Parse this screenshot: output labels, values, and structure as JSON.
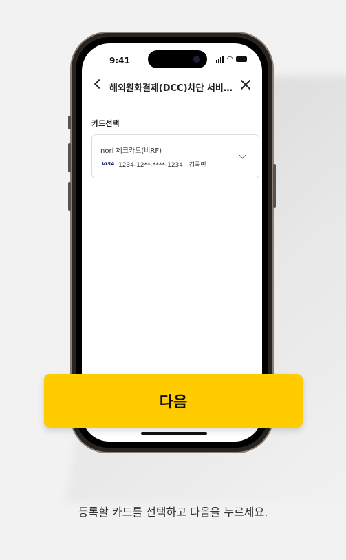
{
  "status_bar": {
    "time": "9:41",
    "icons": [
      "signal-icon",
      "wifi-icon",
      "battery-icon"
    ]
  },
  "navbar": {
    "title": "해외원화결제(DCC)차단 서비스 ...",
    "back_icon": "chevron-left-icon",
    "close_icon": "close-icon"
  },
  "card_section": {
    "label": "카드선택",
    "selected_card": {
      "name": "nori 체크카드(비RF)",
      "brand": "VISA",
      "number_and_owner": "1234-12**-****-1234 | 김국민"
    }
  },
  "next_button": {
    "label": "다음",
    "color": "#ffcc00"
  },
  "caption": "등록할 카드를 선택하고 다음을 누르세요."
}
